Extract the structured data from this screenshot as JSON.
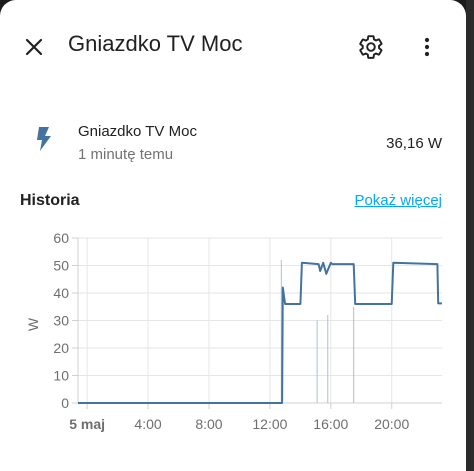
{
  "header": {
    "title": "Gniazdko TV Moc",
    "icons": {
      "close": "close-icon",
      "settings": "gear-icon",
      "more": "more-vertical-icon"
    }
  },
  "entity": {
    "name": "Gniazdko TV Moc",
    "last_changed": "1 minutę temu",
    "value": "36,16 W",
    "icon": "flash-icon",
    "icon_color": "#44739e"
  },
  "history": {
    "title": "Historia",
    "show_more": "Pokaż więcej",
    "link_color": "#03a9f4"
  },
  "chart_data": {
    "type": "line",
    "ylabel": "W",
    "ylim": [
      0,
      60
    ],
    "yticks": [
      "0",
      "10",
      "20",
      "30",
      "40",
      "50",
      "60"
    ],
    "x_ticks": [
      {
        "t": 0,
        "label": "5 maj",
        "bold": true
      },
      {
        "t": 4,
        "label": "4:00"
      },
      {
        "t": 8,
        "label": "8:00"
      },
      {
        "t": 12,
        "label": "12:00"
      },
      {
        "t": 16,
        "label": "16:00"
      },
      {
        "t": 20,
        "label": "20:00"
      }
    ],
    "xlim": [
      -0.6,
      23.3
    ],
    "series": [
      {
        "color": "#44739e",
        "x": [
          -0.6,
          12.8,
          12.85,
          13.0,
          14.0,
          14.1,
          15.2,
          15.3,
          15.5,
          15.7,
          16.0,
          16.1,
          17.5,
          17.6,
          20.0,
          20.1,
          23.0,
          23.05,
          23.3
        ],
        "y": [
          0,
          0,
          42,
          36,
          36,
          51,
          50.5,
          48,
          51,
          47,
          51,
          50.5,
          50.5,
          36,
          36,
          51,
          50.5,
          36.2,
          36.2
        ]
      }
    ],
    "ghost_spikes": [
      {
        "x": 12.75,
        "y": 52
      },
      {
        "x": 15.1,
        "y": 30
      },
      {
        "x": 15.8,
        "y": 32
      },
      {
        "x": 17.5,
        "y": 35
      }
    ]
  }
}
